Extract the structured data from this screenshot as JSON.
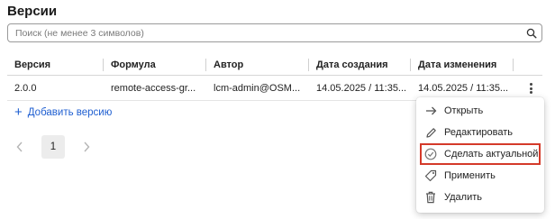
{
  "page": {
    "title": "Версии"
  },
  "search": {
    "placeholder": "Поиск (не менее 3 символов)"
  },
  "table": {
    "columns": [
      "Версия",
      "Формула",
      "Автор",
      "Дата создания",
      "Дата изменения"
    ],
    "rows": [
      {
        "version": "2.0.0",
        "formula": "remote-access-gr...",
        "author": "lcm-admin@OSM...",
        "created": "14.05.2025 / 11:35...",
        "modified": "14.05.2025 / 11:35..."
      }
    ]
  },
  "add_version": {
    "label": "Добавить версию"
  },
  "pagination": {
    "current_page": "1"
  },
  "context_menu": {
    "items": [
      {
        "label": "Открыть",
        "icon": "arrow-right-icon"
      },
      {
        "label": "Редактировать",
        "icon": "pencil-icon"
      },
      {
        "label": "Сделать актуальной",
        "icon": "check-circle-icon",
        "highlighted": true
      },
      {
        "label": "Применить",
        "icon": "tag-icon"
      },
      {
        "label": "Удалить",
        "icon": "trash-icon"
      }
    ]
  },
  "colors": {
    "accent": "#1f5fd1",
    "highlight_border": "#d43a2a"
  }
}
